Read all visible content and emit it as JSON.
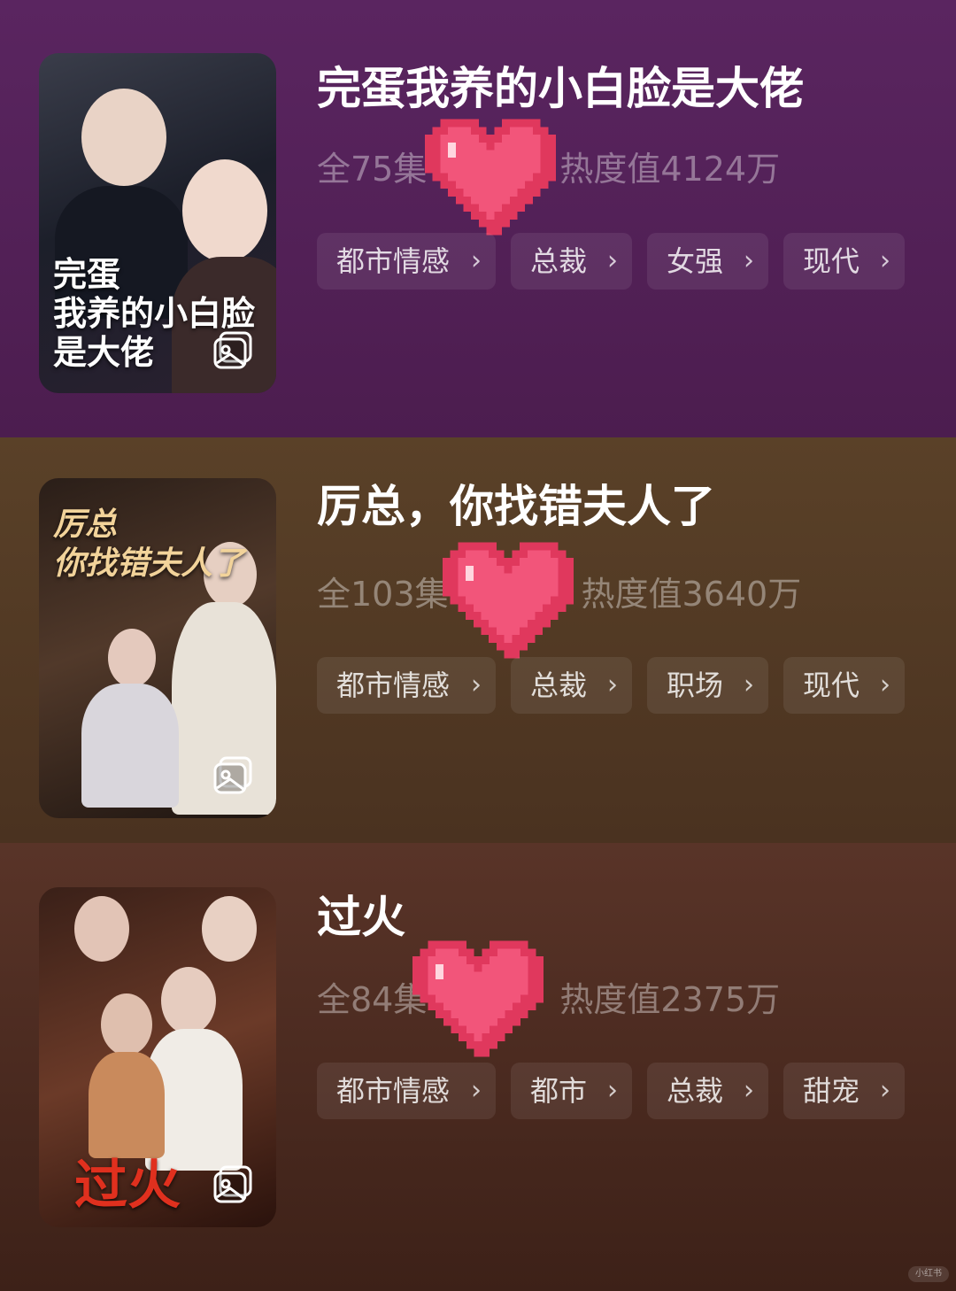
{
  "dramas": [
    {
      "title": "完蛋我养的小白脸是大佬",
      "episodes": "全75集",
      "heat": "热度值4124万",
      "poster_title": "完蛋\n我养的小白脸\n是大佬",
      "tags": [
        "都市情感",
        "总裁",
        "女强",
        "现代"
      ]
    },
    {
      "title": "厉总，你找错夫人了",
      "episodes": "全103集",
      "heat": "热度值3640万",
      "poster_title": "厉总\n你找错夫人了",
      "tags": [
        "都市情感",
        "总裁",
        "职场",
        "现代"
      ]
    },
    {
      "title": "过火",
      "episodes": "全84集",
      "heat": "热度值2375万",
      "poster_title": "过火",
      "tags": [
        "都市情感",
        "都市",
        "总裁",
        "甜宠"
      ]
    }
  ],
  "tag_chevron": "›",
  "icons": {
    "poster_badge": "gallery-icon",
    "sticker": "pixel-heart-icon"
  },
  "colors": {
    "heart": "#f2557a",
    "heart_outline": "#e0385d",
    "heart_shine": "#ffd6df"
  },
  "watermark": "小红书"
}
